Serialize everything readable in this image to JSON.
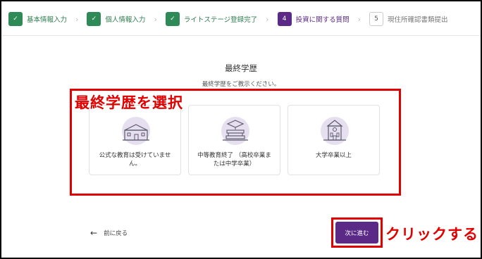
{
  "stepper": {
    "steps": [
      {
        "indicator": "✓",
        "label": "基本情報入力",
        "state": "done"
      },
      {
        "indicator": "✓",
        "label": "個人情報入力",
        "state": "done"
      },
      {
        "indicator": "✓",
        "label": "ライトステージ登録完了",
        "state": "done"
      },
      {
        "indicator": "4",
        "label": "投資に関する質問",
        "state": "current"
      },
      {
        "indicator": "5",
        "label": "現住所確認書類提出",
        "state": "todo"
      }
    ],
    "separator": "›"
  },
  "main": {
    "title": "最終学歴",
    "subtitle": "最終学歴をご教示ください。"
  },
  "annotation": {
    "select_label": "最終学歴を選択",
    "click_label": "クリックする",
    "color": "#e00000"
  },
  "options": [
    {
      "label": "公式な教育は受けていません。",
      "icon": "school-building-icon"
    },
    {
      "label": "中等教育終了 （高校卒業または中学卒業）",
      "icon": "graduation-books-icon"
    },
    {
      "label": "大学卒業以上",
      "icon": "university-building-icon"
    }
  ],
  "footer": {
    "back_label": "前に戻る",
    "back_icon": "arrow-left-icon",
    "next_label": "次に進む"
  },
  "colors": {
    "accent": "#5b2a86",
    "done": "#2e8b57",
    "icon_bg": "#e6dff0"
  }
}
